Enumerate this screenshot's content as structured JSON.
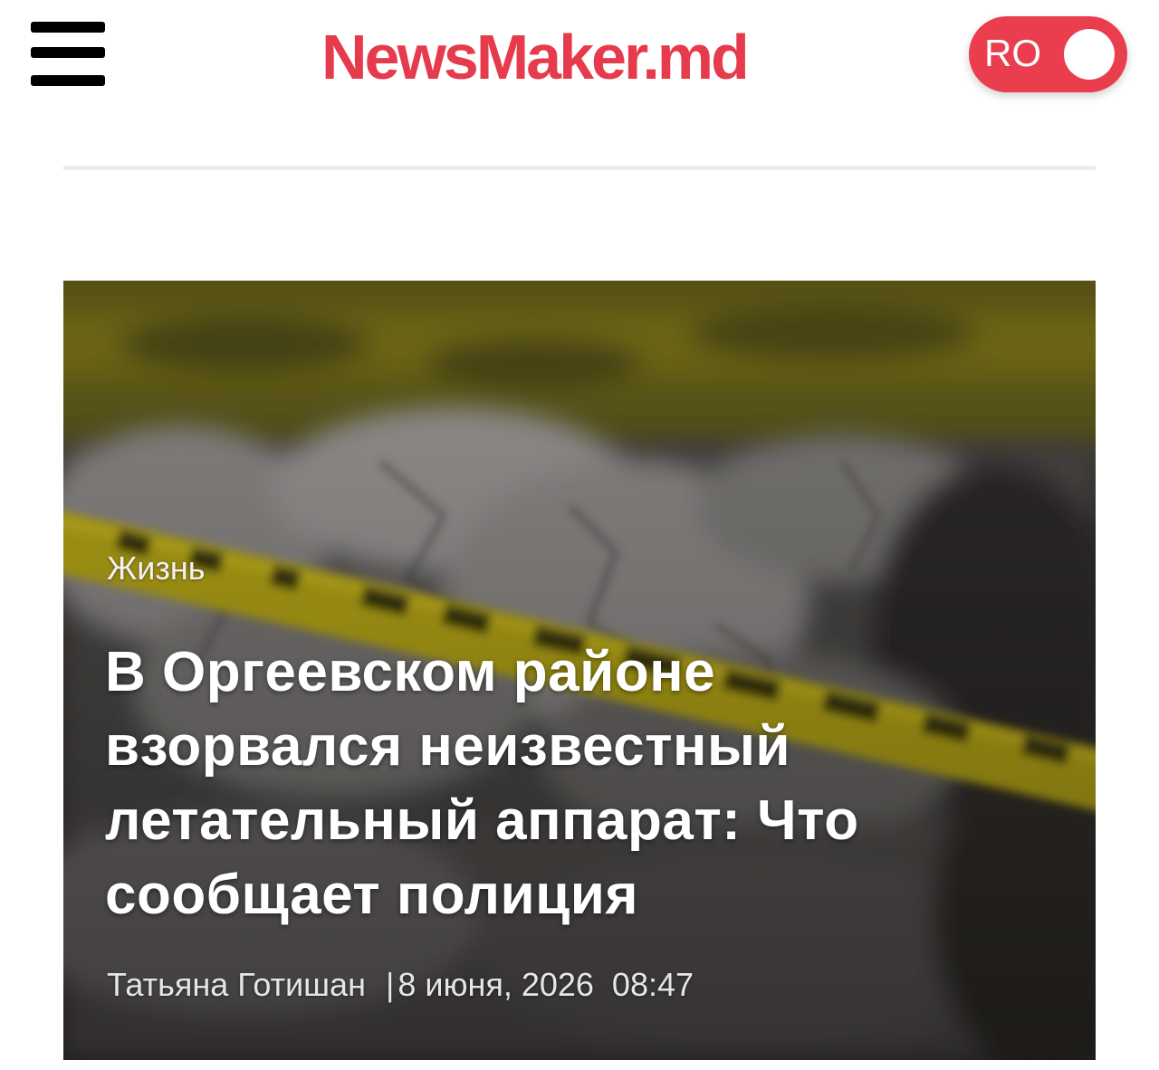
{
  "header": {
    "logo": "NewsMaker.md",
    "language_toggle": "RO",
    "menu_icon": "hamburger-menu-icon"
  },
  "featured_article": {
    "category": "Жизнь",
    "headline": "В Оргеевском районе взорвался неизвестный летательный аппарат: Что сообщает полиция",
    "author": "Татьяна Готишан",
    "separator": "|",
    "date": "8 июня, 2026",
    "time": "08:47"
  },
  "colors": {
    "brand": "#e63b4c",
    "toggle": "#ea3d4e",
    "divider": "#ebebeb"
  }
}
